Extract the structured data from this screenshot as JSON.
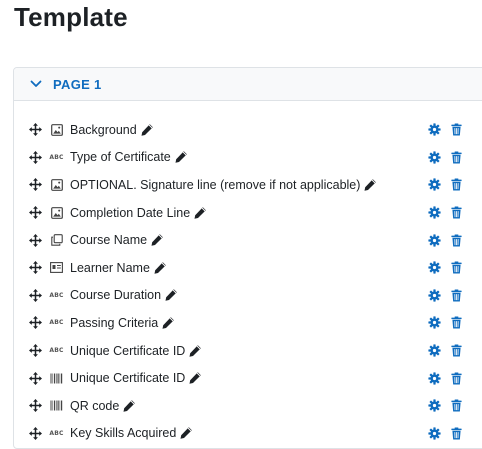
{
  "page": {
    "title": "Template"
  },
  "section": {
    "label": "PAGE 1",
    "expanded": true
  },
  "colors": {
    "accent": "#0f6cbf",
    "text": "#1d2125",
    "border": "#dee2e6",
    "header_bg": "#f8f9fa"
  },
  "elements": [
    {
      "name": "Background",
      "type_icon": "image-icon"
    },
    {
      "name": "Type of Certificate",
      "type_icon": "text-abc-icon"
    },
    {
      "name": "OPTIONAL. Signature line (remove if not applicable)",
      "type_icon": "image-icon"
    },
    {
      "name": "Completion Date Line",
      "type_icon": "image-icon"
    },
    {
      "name": "Course Name",
      "type_icon": "copy-icon"
    },
    {
      "name": "Learner Name",
      "type_icon": "id-card-icon"
    },
    {
      "name": "Course Duration",
      "type_icon": "text-abc-icon"
    },
    {
      "name": "Passing Criteria",
      "type_icon": "text-abc-icon"
    },
    {
      "name": "Unique Certificate ID",
      "type_icon": "text-abc-icon"
    },
    {
      "name": "Unique Certificate ID",
      "type_icon": "barcode-icon"
    },
    {
      "name": "QR code",
      "type_icon": "barcode-icon"
    },
    {
      "name": "Key Skills Acquired",
      "type_icon": "text-abc-icon"
    }
  ]
}
